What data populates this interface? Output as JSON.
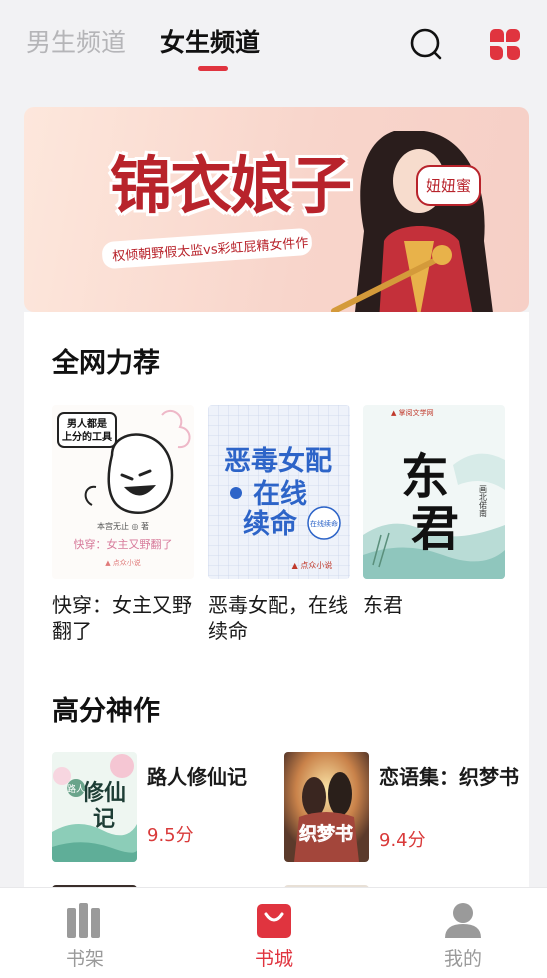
{
  "header": {
    "tabs": [
      {
        "label": "男生频道",
        "active": false
      },
      {
        "label": "女生频道",
        "active": true
      }
    ],
    "search_icon": "search-icon",
    "apps_icon": "four-petal-grid-icon",
    "accent_color": "#e0343f"
  },
  "banner": {
    "title": "锦衣娘子",
    "subtitle": "权倾朝野假太监vs彩虹屁精女件作",
    "badge": "妞妞蜜",
    "pages": 2,
    "current_page": 2
  },
  "sections": {
    "recommend": {
      "title": "全网力荐",
      "books": [
        {
          "title": "快穿：女主又野翻了",
          "cover_text": "男人都是上分的工具",
          "cover_footer": "快穿：女主又野翻了"
        },
        {
          "title": "恶毒女配，在线续命",
          "cover_text": "恶毒女配在线续命"
        },
        {
          "title": "东君",
          "cover_text": "东君"
        }
      ]
    },
    "top_rated": {
      "title": "高分神作",
      "books": [
        {
          "title": "路人修仙记",
          "score": "9.5分",
          "cover_text": "路人修仙记"
        },
        {
          "title": "恋语集：织梦书",
          "score": "9.4分",
          "cover_text": "织梦书"
        }
      ]
    }
  },
  "bottom_nav": [
    {
      "label": "书架",
      "icon": "bookshelf-icon",
      "active": false
    },
    {
      "label": "书城",
      "icon": "shopping-bag-icon",
      "active": true
    },
    {
      "label": "我的",
      "icon": "user-icon",
      "active": false
    }
  ]
}
